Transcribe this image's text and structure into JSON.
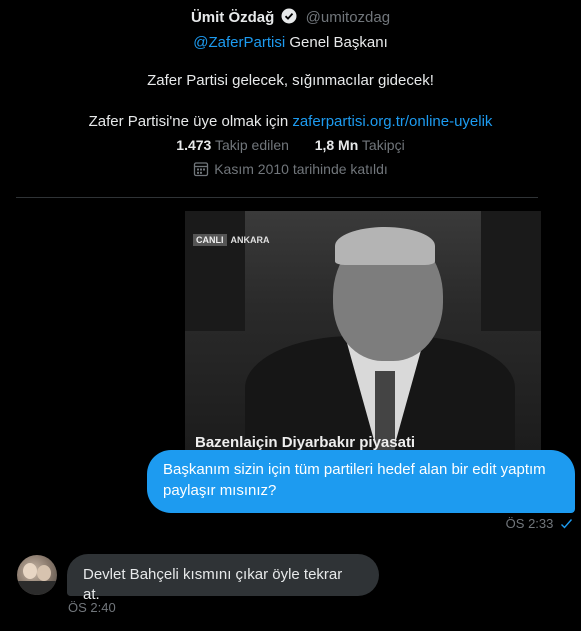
{
  "profile": {
    "name": "Ümit Özdağ",
    "handle": "@umitozdag",
    "bio_mention": "@ZaferPartisi",
    "bio_title": " Genel Başkanı",
    "bio_slogan": "Zafer Partisi gelecek, sığınmacılar gidecek!",
    "bio_membership_prefix": "Zafer Partisi'ne üye olmak için ",
    "bio_link": "zaferpartisi.org.tr/online-uyelik",
    "following_count": "1.473",
    "following_label": "Takip edilen",
    "followers_count": "1,8 Mn",
    "followers_label": "Takipçi",
    "joined": "Kasım 2010 tarihinde katıldı"
  },
  "media": {
    "live_label": "CANLI",
    "location": "ANKARA",
    "subtitle": "Bazenlaiçin Diyarbakır piyasati"
  },
  "messages": [
    {
      "text": "Başkanım sizin için tüm partileri hedef alan bir edit yaptım paylaşır mısınız?",
      "time": "ÖS 2:33",
      "status_icon": "double-check-icon"
    },
    {
      "text": "Devlet Bahçeli kısmını çıkar öyle tekrar at.",
      "time": "ÖS 2:40"
    }
  ],
  "colors": {
    "background": "#000000",
    "accent": "#1d9bf0",
    "incoming_bubble": "#2f3336",
    "muted": "#71767b"
  }
}
